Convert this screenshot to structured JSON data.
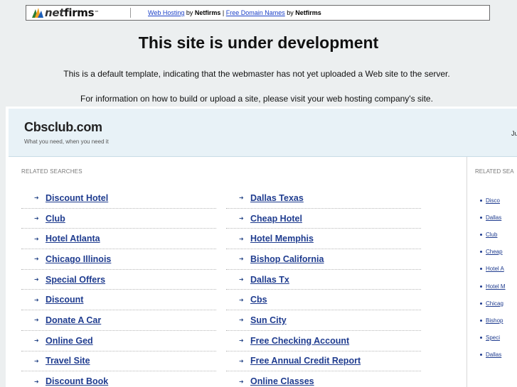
{
  "topbar": {
    "logo_left": "net",
    "logo_right": "firms",
    "logo_tm": "™",
    "link1": "Web Hosting",
    "by1": " by ",
    "brand1": "Netfirms",
    "pipe": " | ",
    "link2": "Free Domain Names",
    "by2": " by ",
    "brand2": "Netfirms"
  },
  "notice": {
    "title": "This site is under development",
    "line1": "This is a default template, indicating that the webmaster has not yet uploaded a Web site to the server.",
    "line2": "For information on how to build or upload a site, please visit your web hosting company's site."
  },
  "header": {
    "site_name": "Cbsclub.com",
    "tagline": "What you need, when you need it",
    "right_text": "Ju"
  },
  "main": {
    "label": "RELATED SEARCHES",
    "left": [
      "Discount Hotel",
      "Club",
      "Hotel Atlanta",
      "Chicago Illinois",
      "Special Offers",
      "Discount",
      "Donate A Car",
      "Online Ged",
      "Travel Site",
      "Discount Book"
    ],
    "right": [
      "Dallas Texas",
      "Cheap Hotel",
      "Hotel Memphis",
      "Bishop California",
      "Dallas Tx",
      "Cbs",
      "Sun City",
      "Free Checking Account",
      "Free Annual Credit Report",
      "Online Classes"
    ]
  },
  "side": {
    "label": "RELATED SEA",
    "items": [
      "Disco",
      "Dallas",
      "Club",
      "Cheap",
      "Hotel A",
      "Hotel M",
      "Chicag",
      "Bishop",
      "Speci",
      "Dallas"
    ]
  },
  "colors": {
    "link": "#1f3c8f",
    "header_bg": "#e8f2f7",
    "page_bg": "#eceff0"
  }
}
